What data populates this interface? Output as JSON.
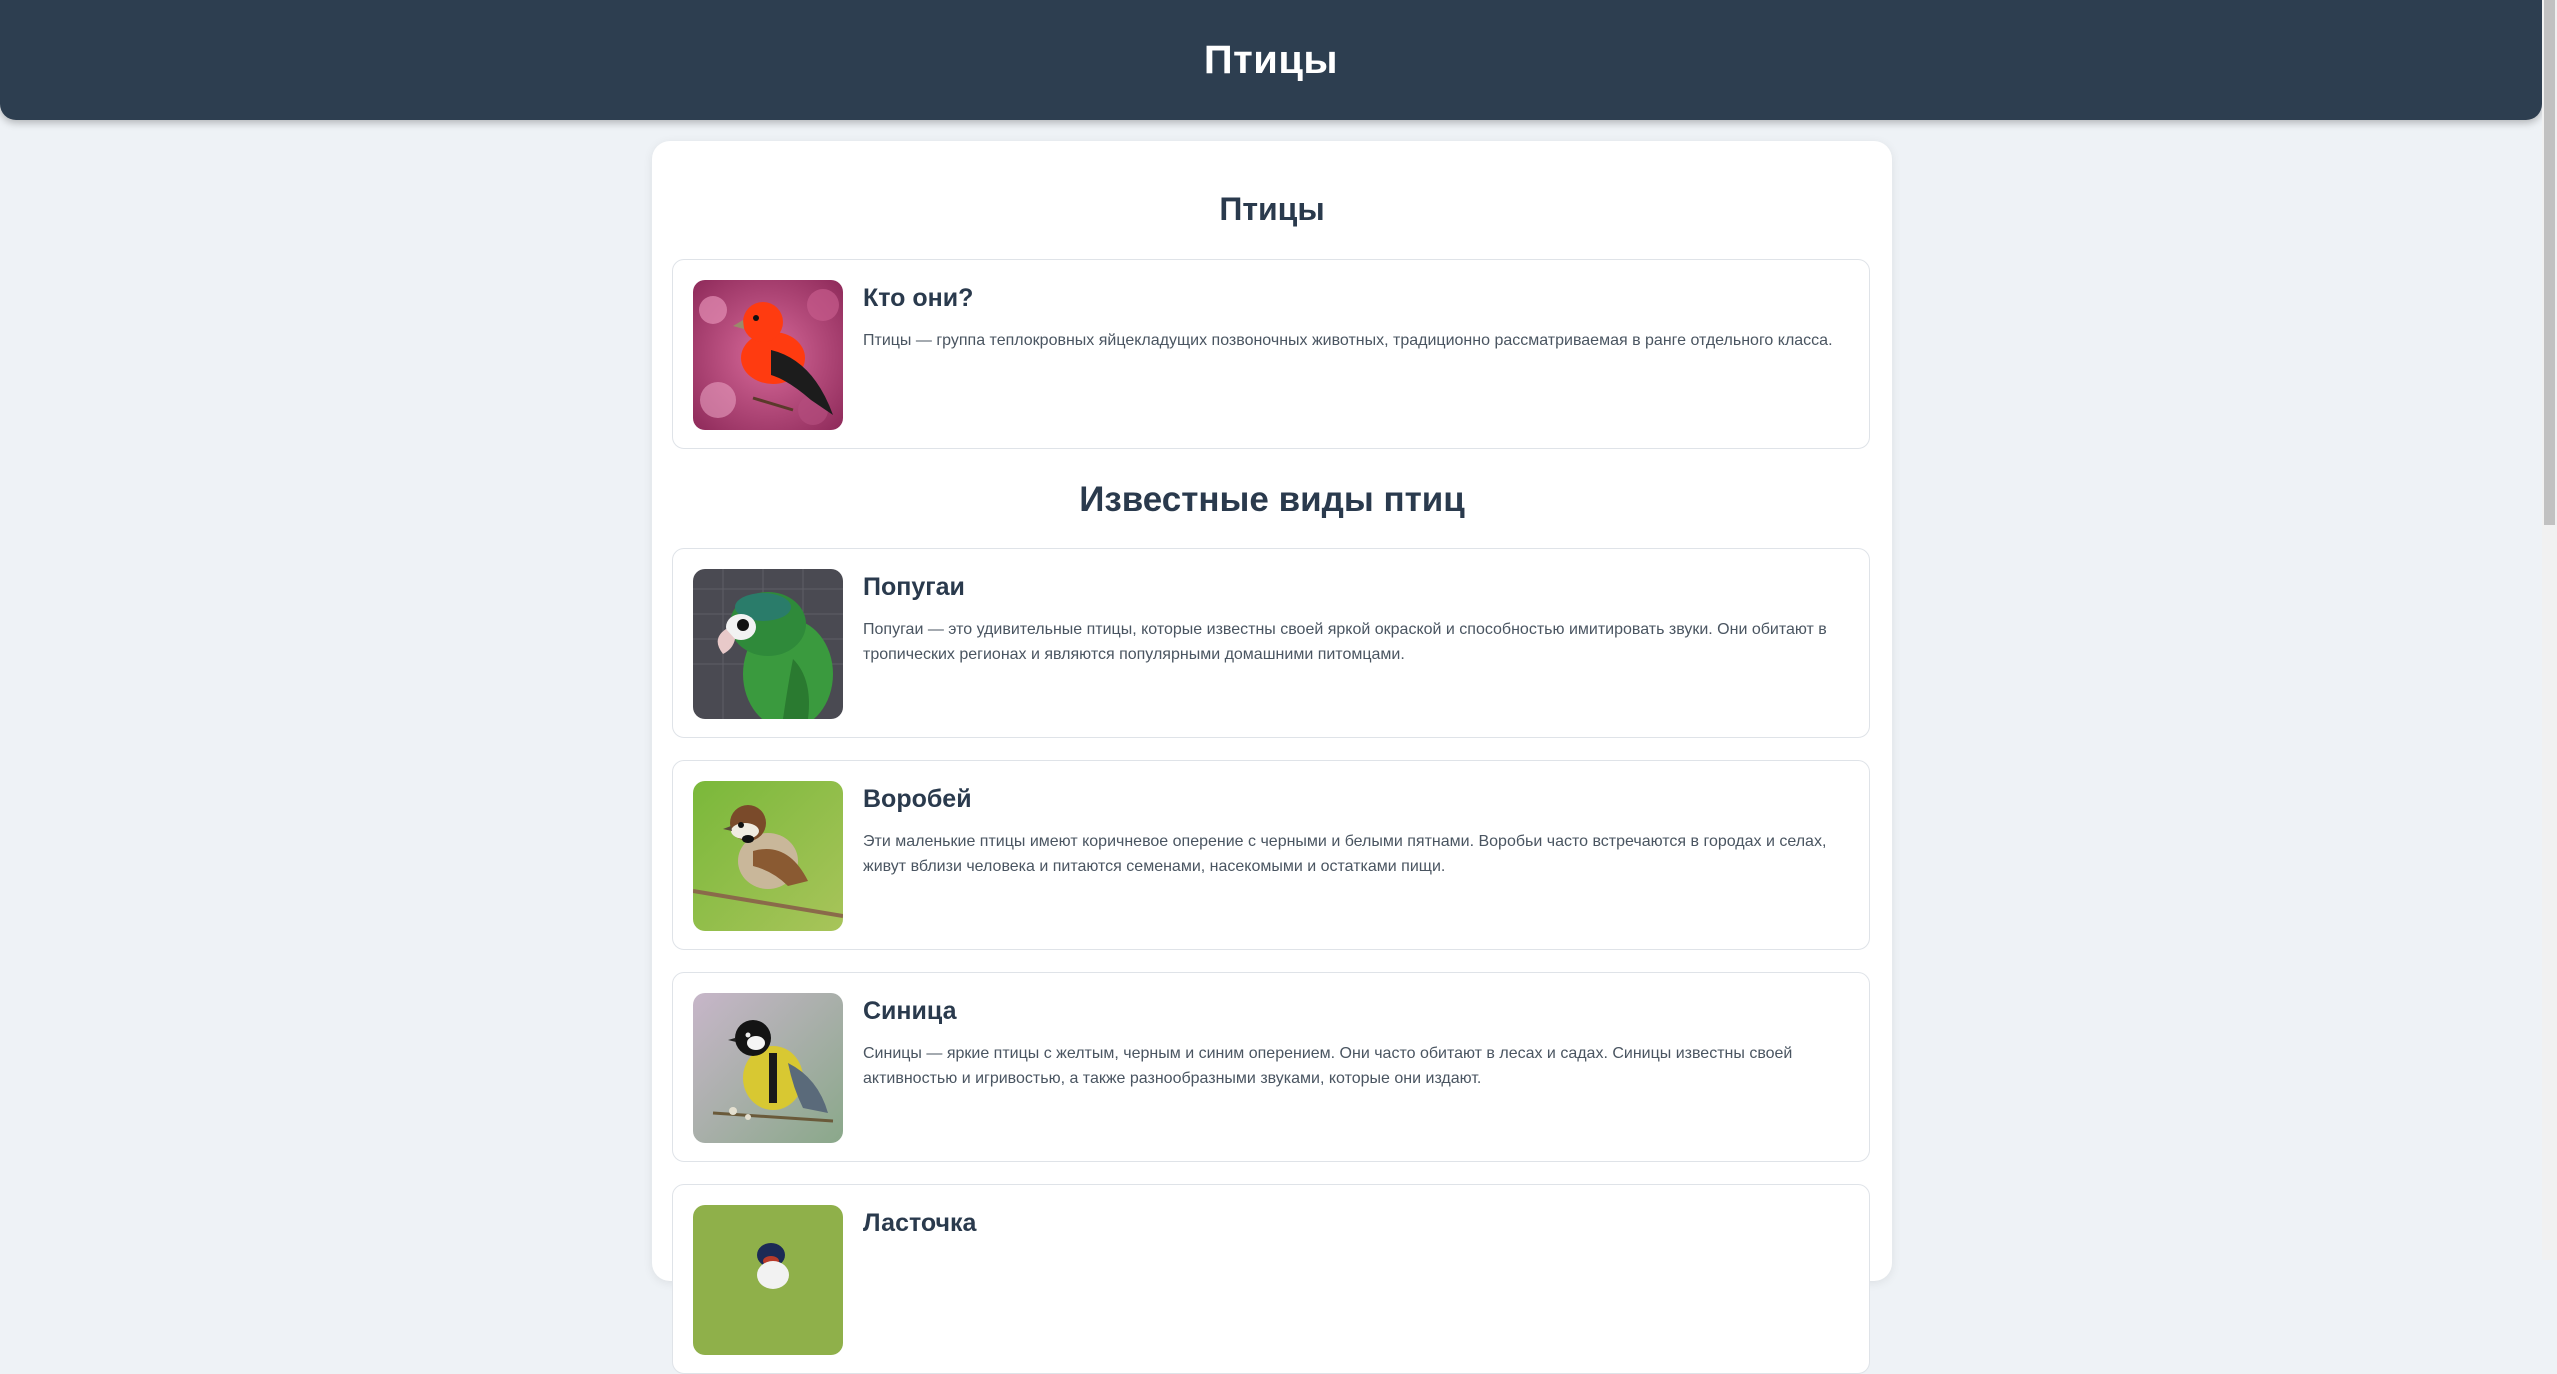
{
  "header": {
    "title": "Птицы"
  },
  "intro": {
    "heading": "Птицы",
    "card": {
      "title": "Кто они?",
      "text": "Птицы — группа теплокровных яйцекладущих позвоночных животных, традиционно рассматриваемая в ранге отдельного класса.",
      "image_icon": "red-bird-photo"
    }
  },
  "species": {
    "heading": "Известные виды птиц",
    "items": [
      {
        "title": "Попугаи",
        "text": "Попугаи — это удивительные птицы, которые известны своей яркой окраской и способностью имитировать звуки. Они обитают в тропических регионах и являются популярными домашними питомцами.",
        "image_icon": "parrot-photo"
      },
      {
        "title": "Воробей",
        "text": "Эти маленькие птицы имеют коричневое оперение с черными и белыми пятнами. Воробьи часто встречаются в городах и селах, живут вблизи человека и питаются семенами, насекомыми и остатками пищи.",
        "image_icon": "sparrow-photo"
      },
      {
        "title": "Синица",
        "text": "Синицы — яркие птицы с желтым, черным и синим оперением. Они часто обитают в лесах и садах. Синицы известны своей активностью и игривостью, а также разнообразными звуками, которые они издают.",
        "image_icon": "tit-photo"
      },
      {
        "title": "Ласточка",
        "text": "",
        "image_icon": "swallow-photo"
      }
    ]
  },
  "colors": {
    "header_bg": "#2d3e50",
    "page_bg": "#eef2f6",
    "heading_text": "#2a3a4d",
    "body_text": "#4a5561"
  }
}
